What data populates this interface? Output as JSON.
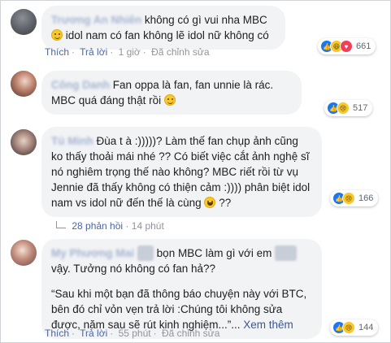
{
  "comments": [
    {
      "name": "Trương An Nhiên",
      "text_before": "không có gì vui nha MBC",
      "text_after": "idol nam có fan không lẽ idol nữ không có",
      "reaction_count": "661",
      "actions": {
        "like": "Thích",
        "reply": "Trả lời",
        "time": "1 giờ",
        "edited": "Đã chỉnh sửa"
      }
    },
    {
      "name": "Công Danh",
      "text_before": "Fan oppa là fan, fan unnie là rác. MBC quá đáng thật rồi",
      "reaction_count": "517"
    },
    {
      "name": "Tú Minh",
      "text_before": "Đùa t à :)))))? Làm thế fan chụp ảnh cũng ko thấy thoải mái nhé ?? Có biết việc cắt ảnh nghệ sĩ nó nghiêm trọng thế nào không? MBC riết rồi từ vụ Jennie đã thấy không có thiện cảm :)))) phân biệt idol nam vs idol nữ đến thế là cùng",
      "text_after": "??",
      "reaction_count": "166",
      "replies": {
        "label": "28 phản hồi",
        "time": "14 phút"
      }
    },
    {
      "name": "My Phương Mai",
      "text_before": "bọn MBC làm gì với em",
      "text_middle": "vậy. Tưởng nó không có fan hả??",
      "quote": "“Sau khi một bạn đã thông báo chuyện này với BTC, bên đó chỉ vỏn vẹn trả lời :Chúng tôi không sửa được, năm sau sẽ rút kinh nghiệm...”...",
      "see_more": "Xem thêm",
      "reaction_count": "144",
      "actions": {
        "like": "Thích",
        "reply": "Trả lời",
        "time": "55 phút",
        "edited": "Đã chỉnh sửa"
      }
    }
  ]
}
